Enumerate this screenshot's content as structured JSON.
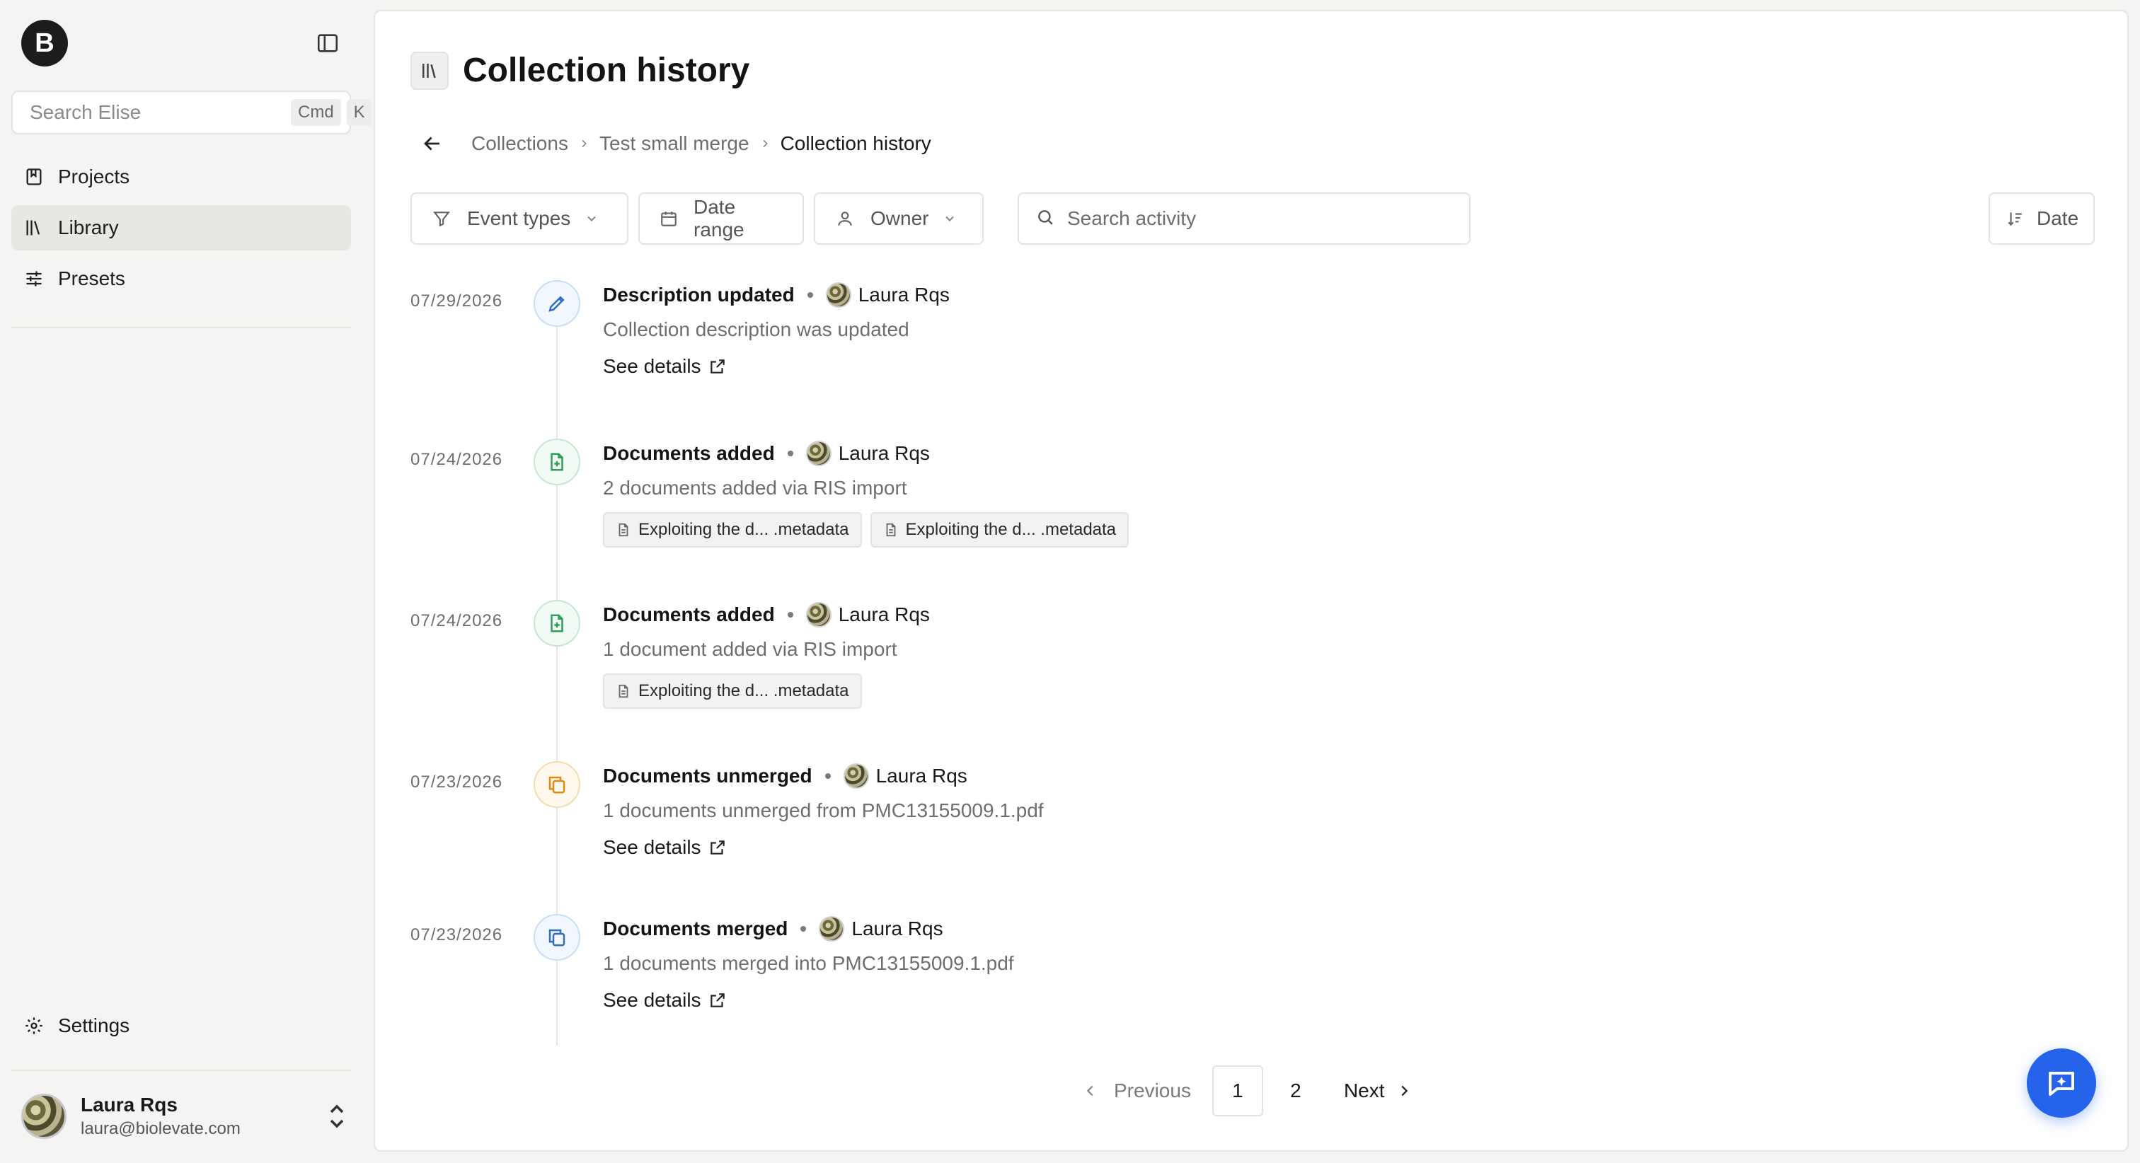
{
  "app": {
    "logo_letter": "B"
  },
  "sidebar": {
    "search_placeholder": "Search Elise",
    "shortcut_mod": "Cmd",
    "shortcut_key": "K",
    "items": [
      {
        "label": "Projects",
        "icon": "book-icon"
      },
      {
        "label": "Library",
        "icon": "library-icon",
        "active": true
      },
      {
        "label": "Presets",
        "icon": "sliders-icon"
      }
    ],
    "settings_label": "Settings",
    "user": {
      "name": "Laura Rqs",
      "email": "laura@biolevate.com"
    }
  },
  "page": {
    "title": "Collection history",
    "breadcrumb": [
      "Collections",
      "Test small merge",
      "Collection history"
    ]
  },
  "filters": {
    "event_types": "Event types",
    "date_range": "Date range",
    "owner": "Owner",
    "search_placeholder": "Search activity",
    "sort": "Date"
  },
  "events": [
    {
      "date": "07/29/2026",
      "title": "Description updated",
      "user": "Laura Rqs",
      "description": "Collection description was updated",
      "link": "See details",
      "icon": "pencil-icon",
      "color": "#2f6fbf"
    },
    {
      "date": "07/24/2026",
      "title": "Documents added",
      "user": "Laura Rqs",
      "description": "2 documents added via RIS import",
      "chips": [
        "Exploiting the d... .metadata",
        "Exploiting the d... .metadata"
      ],
      "icon": "file-plus-icon",
      "color": "#2f9e5b"
    },
    {
      "date": "07/24/2026",
      "title": "Documents added",
      "user": "Laura Rqs",
      "description": "1 document added via RIS import",
      "chips": [
        "Exploiting the d... .metadata"
      ],
      "icon": "file-plus-icon",
      "color": "#2f9e5b"
    },
    {
      "date": "07/23/2026",
      "title": "Documents unmerged",
      "user": "Laura Rqs",
      "description": "1 documents unmerged from PMC13155009.1.pdf",
      "link": "See details",
      "icon": "copy-icon",
      "color": "#e08a12"
    },
    {
      "date": "07/23/2026",
      "title": "Documents merged",
      "user": "Laura Rqs",
      "description": "1 documents merged into PMC13155009.1.pdf",
      "link": "See details",
      "icon": "copy-icon",
      "color": "#2f6fbf"
    }
  ],
  "pagination": {
    "previous": "Previous",
    "pages": [
      "1",
      "2"
    ],
    "current": "1",
    "next": "Next"
  },
  "colors": {
    "accent": "#2563eb"
  }
}
